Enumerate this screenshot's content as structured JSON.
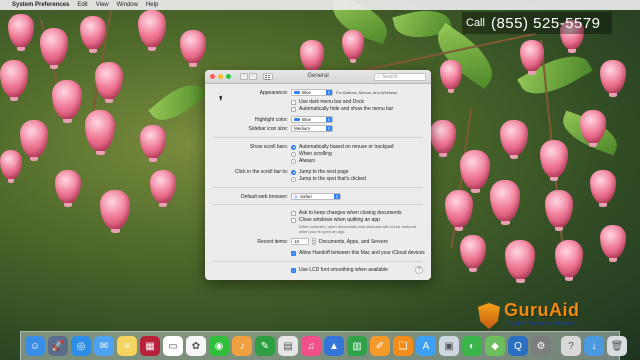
{
  "menubar": {
    "apple_icon": "apple-icon",
    "app_name": "System Preferences",
    "items": [
      "Edit",
      "View",
      "Window",
      "Help"
    ]
  },
  "call_banner": {
    "label": "Call",
    "number": "(855) 525-5579"
  },
  "window": {
    "title": "General",
    "search_placeholder": "Search",
    "appearance": {
      "label": "Appearance:",
      "value": "Blue",
      "hint": "For Buttons, Menus, and Windows",
      "dark_menu_label": "Use dark menu bar and Dock",
      "dark_menu_checked": false,
      "auto_hide_label": "Automatically hide and show the menu bar",
      "auto_hide_checked": false
    },
    "highlight": {
      "label": "Highlight color:",
      "value": "Blue"
    },
    "sidebar_icon": {
      "label": "Sidebar icon size:",
      "value": "Medium"
    },
    "scroll_bars": {
      "label": "Show scroll bars:",
      "options": [
        "Automatically based on mouse or trackpad",
        "When scrolling",
        "Always"
      ],
      "selected": 0
    },
    "click_scroll": {
      "label": "Click in the scroll bar to:",
      "options": [
        "Jump to the next page",
        "Jump to the spot that's clicked"
      ],
      "selected": 0
    },
    "browser": {
      "label": "Default web browser:",
      "value": "Safari"
    },
    "ask_keep_label": "Ask to keep changes when closing documents",
    "ask_keep_checked": false,
    "close_windows_label": "Close windows when quitting an app",
    "close_windows_checked": false,
    "close_windows_note": "When selected, open documents and windows will not be restored when you re-open an app.",
    "recent_items": {
      "label": "Recent items:",
      "value": "10",
      "suffix": "Documents, Apps, and Servers"
    },
    "handoff_label": "Allow Handoff between this Mac and your iCloud devices",
    "handoff_checked": true,
    "lcd_label": "Use LCD font smoothing when available",
    "lcd_checked": true,
    "help_label": "?"
  },
  "logo": {
    "word": "GuruAid",
    "tagline": "Trusted Technical Support"
  },
  "dock": {
    "icons": [
      {
        "name": "finder-icon",
        "color": "#3a8ee6",
        "glyph": "☺"
      },
      {
        "name": "launchpad-icon",
        "color": "#5a6e8c",
        "glyph": "🚀"
      },
      {
        "name": "safari-icon",
        "color": "#2c8ee8",
        "glyph": "◎"
      },
      {
        "name": "mail-icon",
        "color": "#4ea3f0",
        "glyph": "✉"
      },
      {
        "name": "notes-icon",
        "color": "#f4d35e",
        "glyph": "≡"
      },
      {
        "name": "photo-booth-icon",
        "color": "#b7223a",
        "glyph": "▦"
      },
      {
        "name": "calendar-icon",
        "color": "#ffffff",
        "glyph": "▭"
      },
      {
        "name": "photos-icon",
        "color": "#f6f6f6",
        "glyph": "✿"
      },
      {
        "name": "messages-icon",
        "color": "#2fbf3a",
        "glyph": "◉"
      },
      {
        "name": "garageband-icon",
        "color": "#f0a040",
        "glyph": "♪"
      },
      {
        "name": "evernote-icon",
        "color": "#2ea043",
        "glyph": "✎"
      },
      {
        "name": "notes-app-icon",
        "color": "#e6e6e6",
        "glyph": "▤"
      },
      {
        "name": "itunes-icon",
        "color": "#f04f8a",
        "glyph": "♫"
      },
      {
        "name": "keynote-icon",
        "color": "#3575d8",
        "glyph": "▲"
      },
      {
        "name": "numbers-icon",
        "color": "#2ea34a",
        "glyph": "▥"
      },
      {
        "name": "pages-icon",
        "color": "#f39a2a",
        "glyph": "✐"
      },
      {
        "name": "ibooks-icon",
        "color": "#f28c1a",
        "glyph": "❑"
      },
      {
        "name": "app-store-icon",
        "color": "#3da0f4",
        "glyph": "A"
      },
      {
        "name": "preview-icon",
        "color": "#cfd8e0",
        "glyph": "▣"
      },
      {
        "name": "facetime-icon",
        "color": "#3bb54a",
        "glyph": "◐"
      },
      {
        "name": "maps-icon",
        "color": "#6cbf5c",
        "glyph": "◆"
      },
      {
        "name": "quicktime-icon",
        "color": "#2b6fc2",
        "glyph": "Q"
      },
      {
        "name": "system-preferences-icon",
        "color": "#7d7d7d",
        "glyph": "⚙"
      },
      {
        "name": "help-icon",
        "color": "#d9d9d9",
        "glyph": "?"
      },
      {
        "name": "downloads-icon",
        "color": "#4b9ae0",
        "glyph": "↓"
      },
      {
        "name": "trash-icon",
        "color": "#d8dde2",
        "glyph": "🗑"
      }
    ]
  }
}
